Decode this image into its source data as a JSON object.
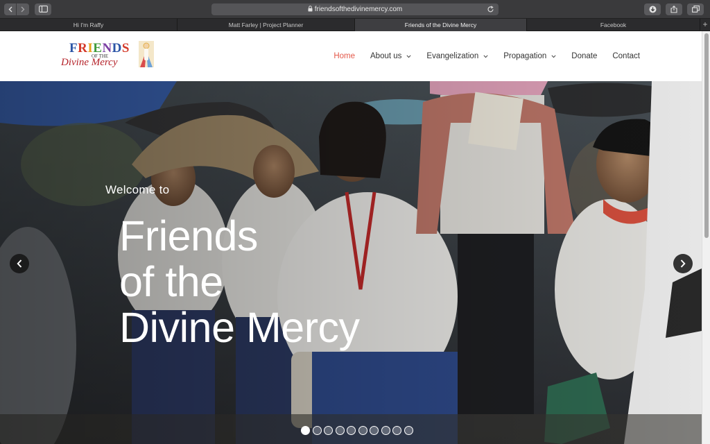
{
  "browser": {
    "url": "friendsofthedivinemercy.com",
    "tabs": [
      {
        "label": "Hi I'm Raffy",
        "active": false
      },
      {
        "label": "Matt Farley | Project Planner",
        "active": false
      },
      {
        "label": "Friends of the Divine Mercy",
        "active": true
      },
      {
        "label": "Facebook",
        "active": false
      }
    ],
    "new_tab": "+"
  },
  "logo": {
    "line1_letters": [
      "F",
      "R",
      "I",
      "E",
      "N",
      "D",
      "S"
    ],
    "line2": "OF THE",
    "line3": "Divine Mercy"
  },
  "nav": {
    "items": [
      {
        "label": "Home",
        "active": true,
        "dropdown": false
      },
      {
        "label": "About us",
        "active": false,
        "dropdown": true
      },
      {
        "label": "Evangelization",
        "active": false,
        "dropdown": true
      },
      {
        "label": "Propagation",
        "active": false,
        "dropdown": true
      },
      {
        "label": "Donate",
        "active": false,
        "dropdown": false
      },
      {
        "label": "Contact",
        "active": false,
        "dropdown": false
      }
    ],
    "active_color": "#e4584a"
  },
  "hero": {
    "welcome": "Welcome to",
    "title_lines": [
      "Friends",
      "of the",
      "Divine Mercy"
    ],
    "slide_count": 10,
    "active_slide": 1
  }
}
